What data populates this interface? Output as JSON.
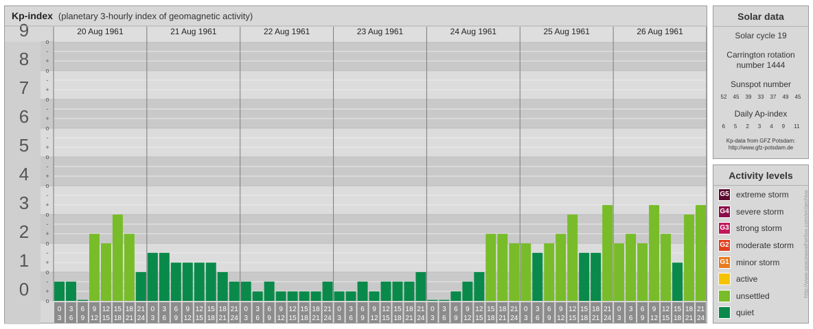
{
  "header": {
    "title": "Kp-index",
    "subtitle": "(planetary 3-hourly index of geomagnetic activity)"
  },
  "chart_data": {
    "type": "bar",
    "title": "Kp-index",
    "subtitle": "(planetary 3-hourly index of geomagnetic activity)",
    "ylim": [
      0,
      9
    ],
    "ytick_labels": [
      "0",
      "1",
      "2",
      "3",
      "4",
      "5",
      "6",
      "7",
      "8",
      "9"
    ],
    "subdivision_labels": [
      "-",
      "o",
      "+"
    ],
    "days": [
      "20 Aug 1961",
      "21 Aug 1961",
      "22 Aug 1961",
      "23 Aug 1961",
      "24 Aug 1961",
      "25 Aug 1961",
      "26 Aug 1961"
    ],
    "interval_start_labels": [
      "0",
      "3",
      "6",
      "9",
      "12",
      "15",
      "18",
      "21"
    ],
    "interval_end_labels": [
      "3",
      "6",
      "9",
      "12",
      "15",
      "18",
      "21",
      "24"
    ],
    "values": [
      0.67,
      0.67,
      0.0,
      2.33,
      2.0,
      3.0,
      2.33,
      1.0,
      1.67,
      1.67,
      1.33,
      1.33,
      1.33,
      1.33,
      1.0,
      0.67,
      0.67,
      0.33,
      0.67,
      0.33,
      0.33,
      0.33,
      0.33,
      0.67,
      0.33,
      0.33,
      0.67,
      0.33,
      0.67,
      0.67,
      0.67,
      1.0,
      0.0,
      0.0,
      0.33,
      0.67,
      1.0,
      2.33,
      2.33,
      2.0,
      2.0,
      1.67,
      2.0,
      2.33,
      3.0,
      1.67,
      1.67,
      3.33,
      2.0,
      2.33,
      2.0,
      3.33,
      2.33,
      1.33,
      3.0,
      3.33
    ],
    "grid": true,
    "legend": "right",
    "colors": {
      "quiet": "#0a8a4a",
      "unsettled": "#78bc2a",
      "active": "#f6c300",
      "band_dark": "#c9c9c9",
      "band_light": "#dcdcdc",
      "label_box": "#8c8c8c"
    }
  },
  "solar": {
    "heading": "Solar data",
    "cycle": "Solar cycle 19",
    "carrington_line1": "Carrington rotation",
    "carrington_line2": "number 1444",
    "sunspot_label": "Sunspot number",
    "sunspot_values": [
      "52",
      "45",
      "39",
      "33",
      "37",
      "49",
      "45"
    ],
    "ap_label": "Daily Ap-index",
    "ap_values": [
      "6",
      "5",
      "2",
      "3",
      "4",
      "9",
      "11"
    ],
    "source_line1": "Kp-data from GFZ Potsdam:",
    "source_line2": "http://www.gfz-potsdam.de"
  },
  "activity": {
    "heading": "Activity levels",
    "levels": [
      {
        "badge": "G5",
        "label": "extreme storm",
        "color": "#5a0a2e"
      },
      {
        "badge": "G4",
        "label": "severe storm",
        "color": "#8a0e4a"
      },
      {
        "badge": "G3",
        "label": "strong storm",
        "color": "#c2185b"
      },
      {
        "badge": "G2",
        "label": "moderate storm",
        "color": "#e0401e"
      },
      {
        "badge": "G1",
        "label": "minor storm",
        "color": "#e87a1e"
      },
      {
        "badge": "",
        "label": "active",
        "color": "#f6c300"
      },
      {
        "badge": "",
        "label": "unsettled",
        "color": "#78bc2a"
      },
      {
        "badge": "",
        "label": "quiet",
        "color": "#0a8a4a"
      }
    ]
  },
  "side_note": "http://www.spaceweatherlive.com/en/archive"
}
